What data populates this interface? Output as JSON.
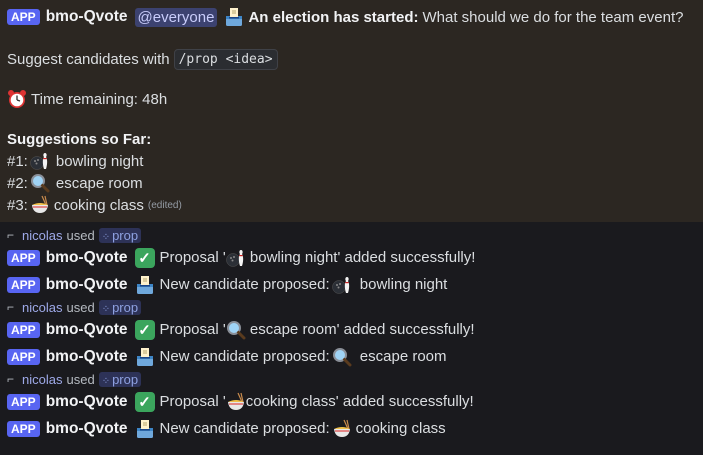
{
  "announcement": {
    "app_badge": "APP",
    "username": "bmo-Qvote",
    "mention": "@everyone",
    "headline": "An election has started:",
    "question": "What should we do for the team event?",
    "suggest_text": "Suggest candidates with",
    "command": "/prop <idea>",
    "time_remaining": "Time remaining: 48h",
    "suggestions_title": "Suggestions so Far:",
    "suggestions": [
      {
        "num": "#1:",
        "icon": "bowling-icon",
        "text": "bowling night"
      },
      {
        "num": "#2:",
        "icon": "magnifier-icon",
        "text": "escape room"
      },
      {
        "num": "#3:",
        "icon": "noodle-bowl-icon",
        "text": "cooking class"
      }
    ],
    "edited_label": "(edited)"
  },
  "replies": [
    {
      "user": "nicolas",
      "used": "used",
      "command": "prop",
      "success": {
        "badge": "APP",
        "username": "bmo-Qvote",
        "text": "Proposal '",
        "item": " bowling night",
        "suffix": "' added successfully!"
      },
      "candidate": {
        "badge": "APP",
        "username": "bmo-Qvote",
        "text": "New candidate proposed:",
        "item": " bowling night"
      }
    },
    {
      "user": "nicolas",
      "used": "used",
      "command": "prop",
      "success": {
        "badge": "APP",
        "username": "bmo-Qvote",
        "text": "Proposal '",
        "item": " escape room",
        "suffix": "' added successfully!"
      },
      "candidate": {
        "badge": "APP",
        "username": "bmo-Qvote",
        "text": "New candidate proposed:",
        "item": " escape room"
      }
    },
    {
      "user": "nicolas",
      "used": "used",
      "command": "prop",
      "success": {
        "badge": "APP",
        "username": "bmo-Qvote",
        "text": "Proposal '",
        "item": "cooking class",
        "suffix": "' added successfully!"
      },
      "candidate": {
        "badge": "APP",
        "username": "bmo-Qvote",
        "text": "New candidate proposed:",
        "item": "cooking class"
      }
    }
  ],
  "colors": {
    "accent": "#5865f2",
    "highlight": "#2c2722",
    "background": "#1a1a1e",
    "check": "#3ba55d"
  }
}
